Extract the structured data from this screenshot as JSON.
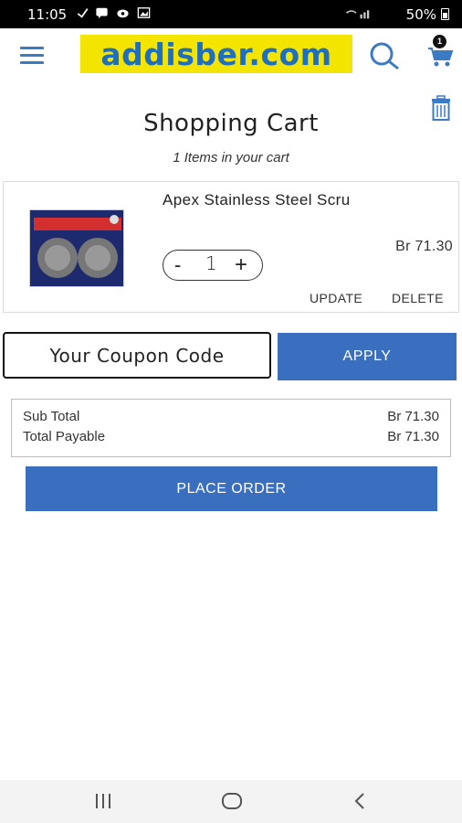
{
  "status_bar": {
    "time": "11:05",
    "battery": "50%"
  },
  "header": {
    "logo_text": "addisber.com",
    "cart_count": "1"
  },
  "page": {
    "title": "Shopping Cart",
    "items_count": "1 Items in your cart"
  },
  "cart_item": {
    "name": "Apex Stainless Steel Scru",
    "quantity": "1",
    "minus_label": "-",
    "plus_label": "+",
    "price": "Br 71.30",
    "update_label": "UPDATE",
    "delete_label": "DELETE"
  },
  "coupon": {
    "placeholder": "Your Coupon Code",
    "apply_label": "APPLY"
  },
  "totals": {
    "sub_total_label": "Sub Total",
    "sub_total_value": "Br 71.30",
    "total_payable_label": "Total Payable",
    "total_payable_value": "Br 71.30"
  },
  "actions": {
    "place_order_label": "PLACE ORDER"
  },
  "colors": {
    "brand_blue": "#3a6fbf",
    "logo_yellow": "#f4e500",
    "logo_text_blue": "#1f6fc0"
  }
}
